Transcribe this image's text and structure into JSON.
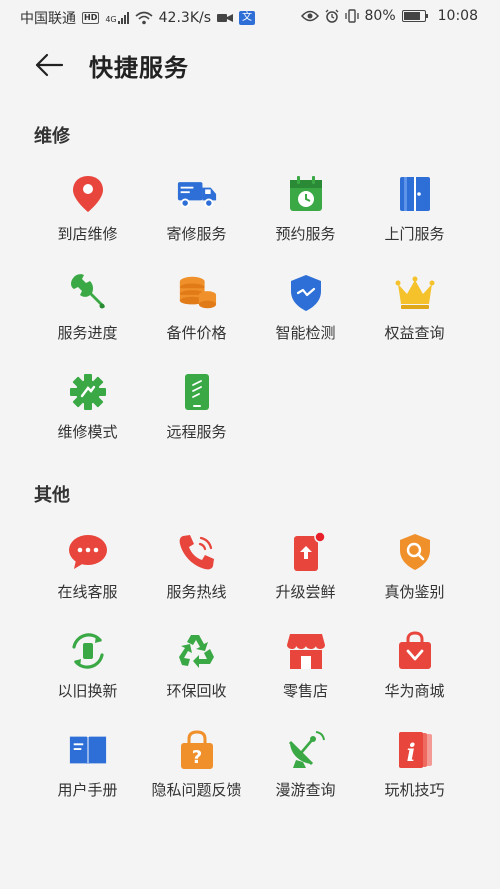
{
  "status_bar": {
    "carrier": "中国联通",
    "network_badge": "HD",
    "network_type": "4G",
    "speed": "42.3K/s",
    "battery": "80%",
    "time": "10:08"
  },
  "header": {
    "title": "快捷服务"
  },
  "sections": [
    {
      "title": "维修",
      "items": [
        {
          "label": "到店维修",
          "icon": "location-pin-icon",
          "color": "#e8453c"
        },
        {
          "label": "寄修服务",
          "icon": "delivery-truck-icon",
          "color": "#2d6fd6"
        },
        {
          "label": "预约服务",
          "icon": "calendar-clock-icon",
          "color": "#3aa845"
        },
        {
          "label": "上门服务",
          "icon": "door-icon",
          "color": "#2d6fd6"
        },
        {
          "label": "服务进度",
          "icon": "wrench-icon",
          "color": "#3aa845"
        },
        {
          "label": "备件价格",
          "icon": "coins-icon",
          "color": "#f0902a"
        },
        {
          "label": "智能检测",
          "icon": "shield-check-icon",
          "color": "#2d6fd6"
        },
        {
          "label": "权益查询",
          "icon": "crown-icon",
          "color": "#f5c22b"
        },
        {
          "label": "维修模式",
          "icon": "gear-icon",
          "color": "#3aa845"
        },
        {
          "label": "远程服务",
          "icon": "phone-remote-icon",
          "color": "#3aa845"
        }
      ]
    },
    {
      "title": "其他",
      "items": [
        {
          "label": "在线客服",
          "icon": "chat-bubble-icon",
          "color": "#e8453c"
        },
        {
          "label": "服务热线",
          "icon": "phone-call-icon",
          "color": "#e8453c"
        },
        {
          "label": "升级尝鲜",
          "icon": "phone-upgrade-icon",
          "color": "#e8453c"
        },
        {
          "label": "真伪鉴别",
          "icon": "shield-search-icon",
          "color": "#f0902a"
        },
        {
          "label": "以旧换新",
          "icon": "trade-in-icon",
          "color": "#3aa845"
        },
        {
          "label": "环保回收",
          "icon": "recycle-icon",
          "color": "#3aa845"
        },
        {
          "label": "零售店",
          "icon": "store-icon",
          "color": "#e8453c"
        },
        {
          "label": "华为商城",
          "icon": "shopping-bag-icon",
          "color": "#e8453c"
        },
        {
          "label": "用户手册",
          "icon": "book-icon",
          "color": "#2d6fd6"
        },
        {
          "label": "隐私问题反馈",
          "icon": "privacy-question-icon",
          "color": "#f0902a"
        },
        {
          "label": "漫游查询",
          "icon": "satellite-dish-icon",
          "color": "#3aa845"
        },
        {
          "label": "玩机技巧",
          "icon": "tips-icon",
          "color": "#e8453c"
        }
      ]
    }
  ]
}
